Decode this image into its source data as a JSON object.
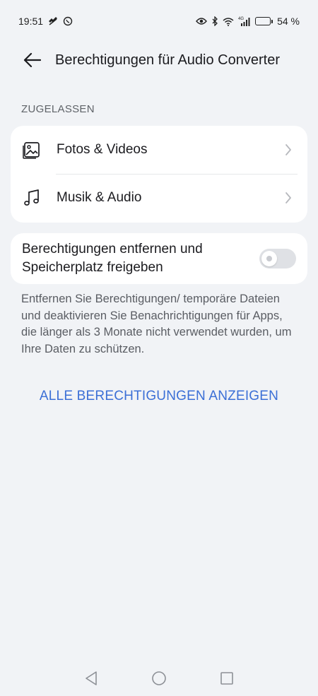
{
  "status_bar": {
    "time": "19:51",
    "battery_percent": "54 %",
    "battery_level": 0.54,
    "network_label": "4G"
  },
  "header": {
    "title": "Berechtigungen für Audio Converter"
  },
  "section": {
    "label": "ZUGELASSEN"
  },
  "permissions": [
    {
      "label": "Fotos & Videos",
      "icon": "image-icon"
    },
    {
      "label": "Musik & Audio",
      "icon": "music-note-icon"
    }
  ],
  "toggle_card": {
    "label": "Berechtigungen entfernen und Speicherplatz freigeben",
    "enabled": false
  },
  "description": "Entfernen Sie Berechtigungen/ temporäre Dateien und deaktivieren Sie Benachrichtigungen für Apps, die länger als 3 Monate nicht verwendet wurden, um Ihre Daten zu schützen.",
  "action_link": "ALLE BERECHTIGUNGEN ANZEIGEN",
  "colors": {
    "background": "#f1f3f6",
    "card": "#ffffff",
    "accent": "#3b6fd6"
  }
}
